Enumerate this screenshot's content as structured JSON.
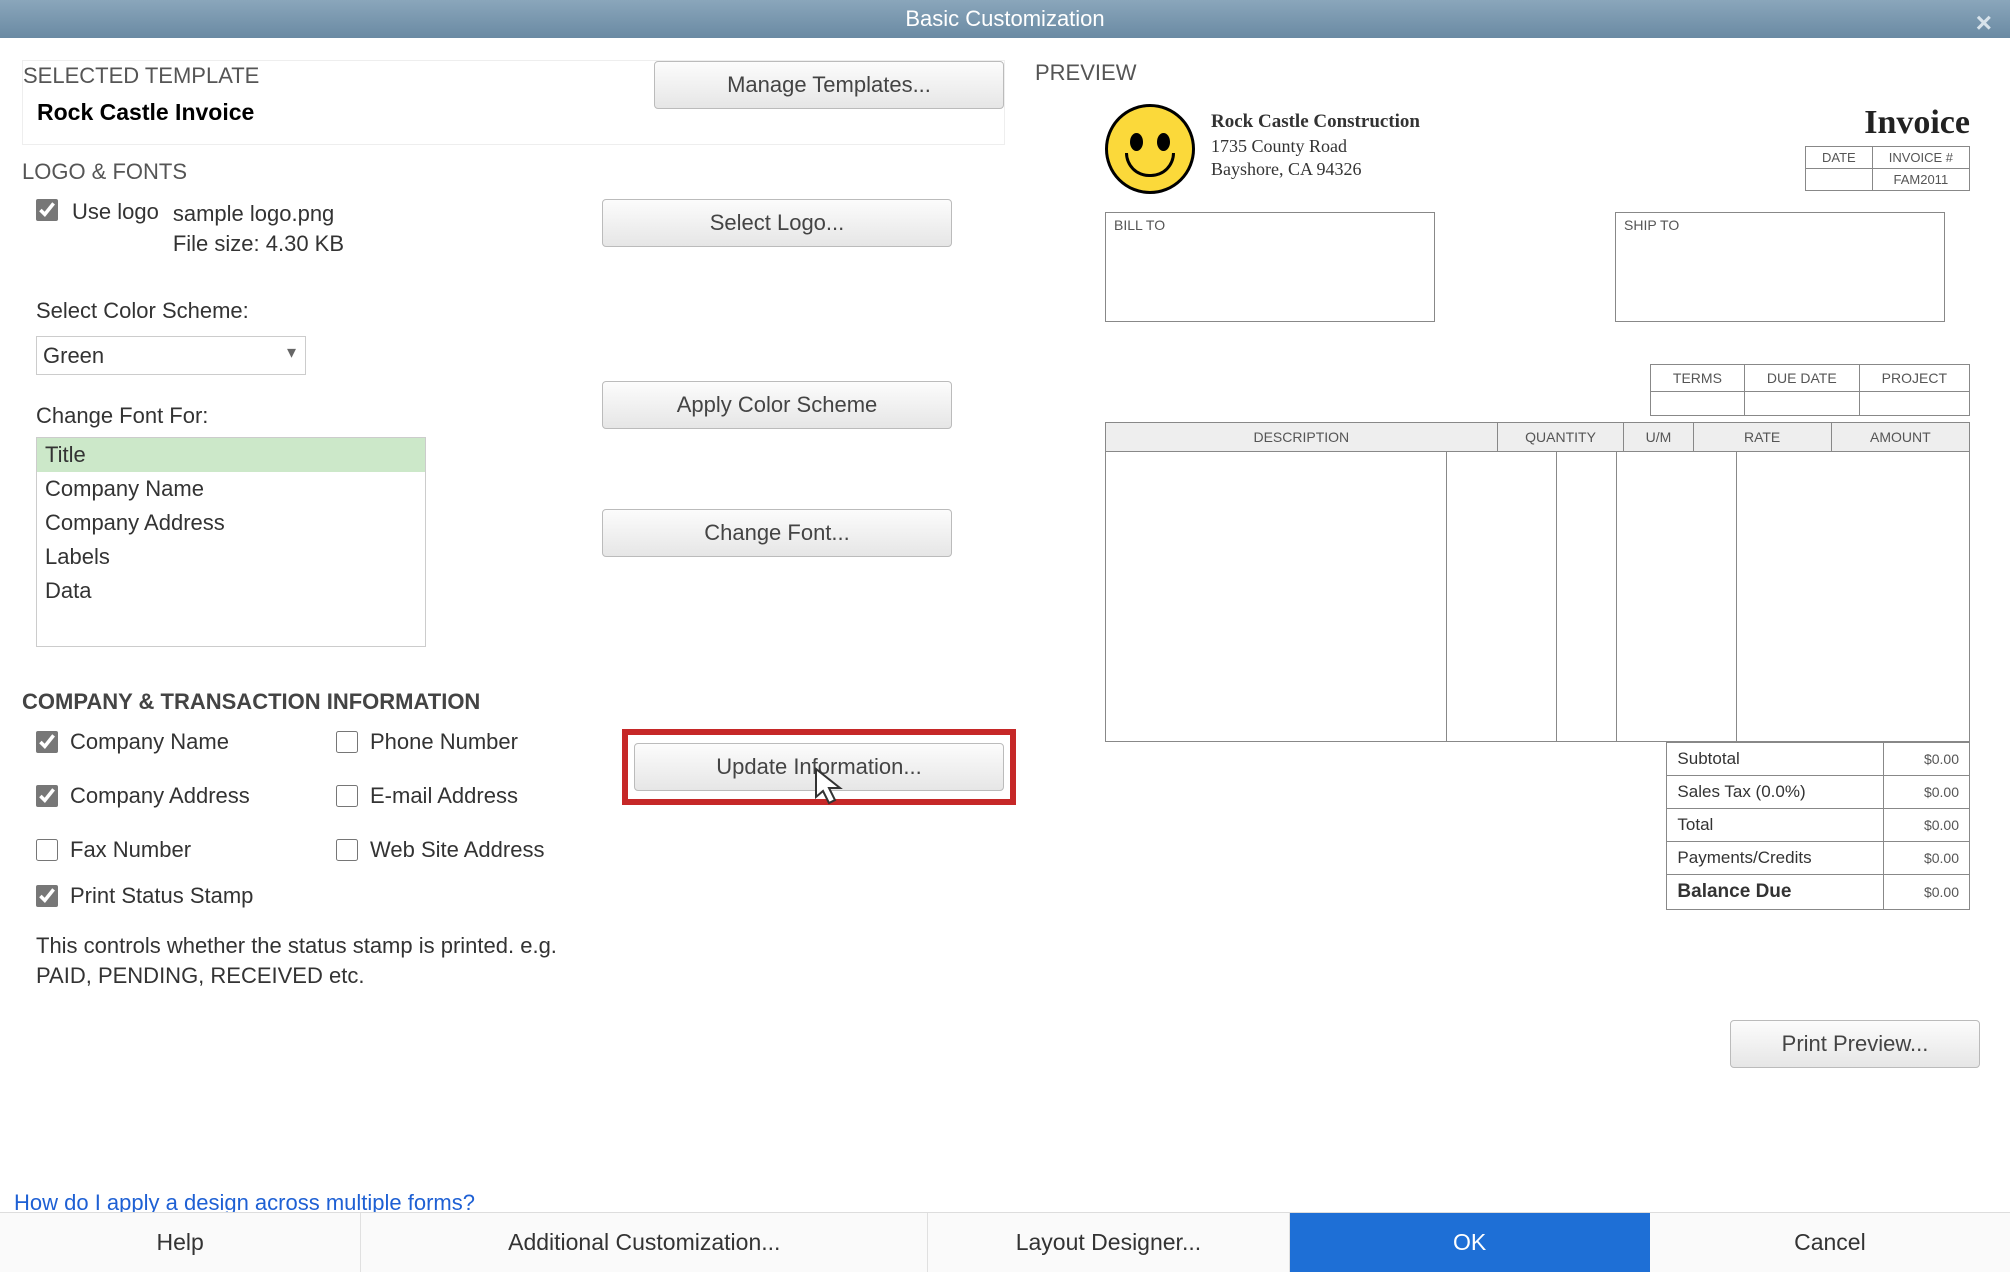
{
  "window": {
    "title": "Basic Customization"
  },
  "sections": {
    "selected_template": "SELECTED TEMPLATE",
    "logo_fonts": "LOGO & FONTS",
    "company_info": "COMPANY & TRANSACTION INFORMATION",
    "preview": "PREVIEW"
  },
  "template": {
    "name": "Rock Castle Invoice",
    "manage_btn": "Manage Templates..."
  },
  "logo": {
    "use_logo_label": "Use logo",
    "filename": "sample logo.png",
    "filesize": "File size: 4.30 KB",
    "select_btn": "Select Logo..."
  },
  "color": {
    "label": "Select Color Scheme:",
    "value": "Green",
    "apply_btn": "Apply Color Scheme"
  },
  "font": {
    "label": "Change Font For:",
    "items": [
      "Title",
      "Company Name",
      "Company Address",
      "Labels",
      "Data"
    ],
    "change_btn": "Change Font..."
  },
  "company": {
    "checks": {
      "company_name": "Company Name",
      "company_address": "Company Address",
      "fax_number": "Fax Number",
      "phone_number": "Phone Number",
      "email_address": "E-mail Address",
      "website": "Web Site Address",
      "print_status": "Print Status Stamp"
    },
    "update_btn": "Update Information...",
    "status_note_1": "This controls whether the status stamp is printed. e.g.",
    "status_note_2": "PAID, PENDING, RECEIVED etc."
  },
  "help_link": "How do I apply a design across multiple forms?",
  "preview": {
    "company_name": "Rock Castle Construction",
    "addr1": "1735 County Road",
    "addr2": "Bayshore, CA 94326",
    "invoice_title": "Invoice",
    "date_lbl": "DATE",
    "invnum_lbl": "INVOICE #",
    "invnum_val": "FAM2011",
    "billto": "BILL TO",
    "shipto": "SHIP TO",
    "terms": "TERMS",
    "duedate": "DUE DATE",
    "project": "PROJECT",
    "cols": {
      "desc": "DESCRIPTION",
      "qty": "QUANTITY",
      "um": "U/M",
      "rate": "RATE",
      "amount": "AMOUNT"
    },
    "totals": {
      "subtotal": "Subtotal",
      "salestax": "Sales Tax  (0.0%)",
      "total": "Total",
      "payments": "Payments/Credits",
      "balance": "Balance Due",
      "zero": "$0.00"
    },
    "print_preview_btn": "Print Preview..."
  },
  "footer": {
    "help": "Help",
    "additional": "Additional Customization...",
    "layout": "Layout Designer...",
    "ok": "OK",
    "cancel": "Cancel"
  }
}
